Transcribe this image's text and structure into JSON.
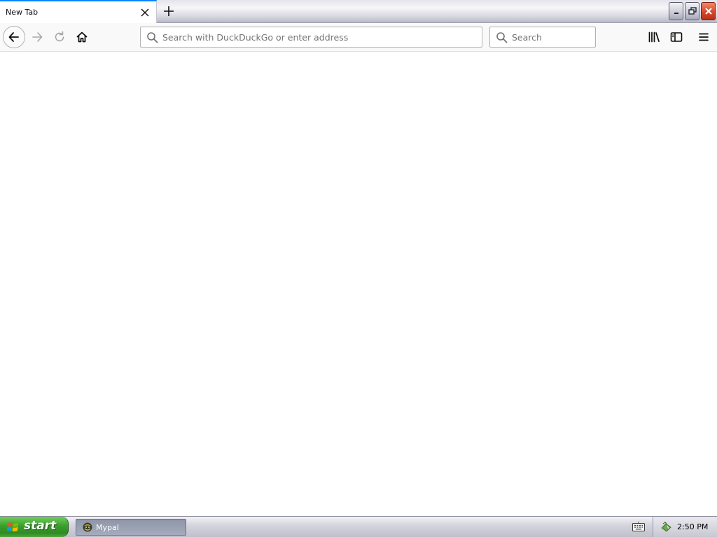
{
  "tabs": [
    {
      "title": "New Tab",
      "active": true
    }
  ],
  "navbar": {
    "url_placeholder": "Search with DuckDuckGo or enter address",
    "url_value": "",
    "search_placeholder": "Search",
    "search_value": ""
  },
  "icons": {
    "back": "arrow-left-icon",
    "forward": "arrow-right-icon",
    "reload": "reload-icon",
    "home": "home-icon",
    "library": "library-icon",
    "sidebar": "sidebar-icon",
    "menu": "hamburger-menu-icon"
  },
  "taskbar": {
    "start_label": "start",
    "task_label": "Mypal",
    "clock": "2:50 PM"
  },
  "colors": {
    "tab_accent": "#0a84ff",
    "start_green": "#3a9f2c",
    "close_red": "#d8462a"
  }
}
